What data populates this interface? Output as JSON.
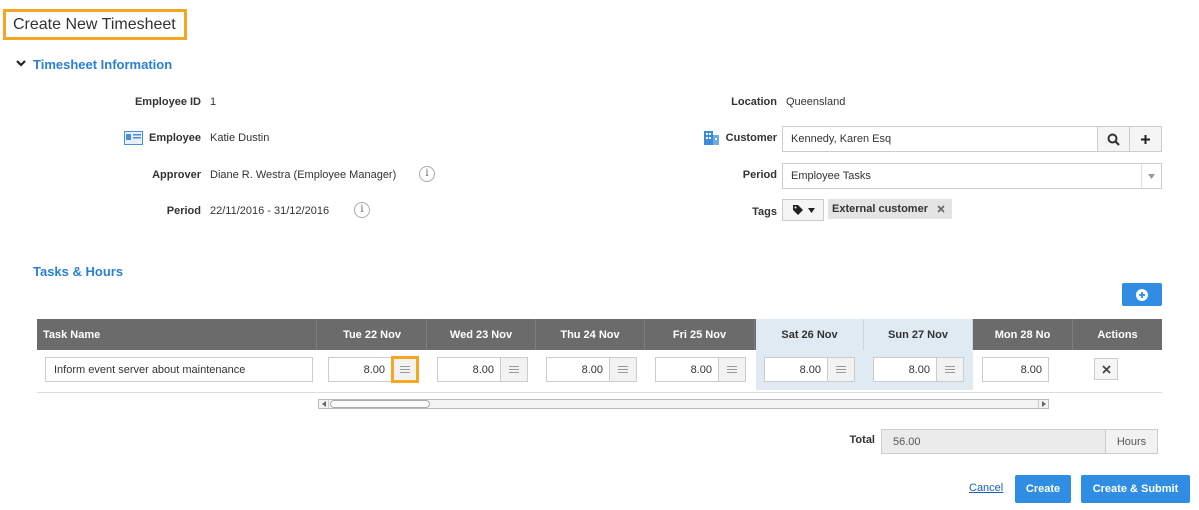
{
  "page": {
    "title": "Create New Timesheet"
  },
  "info_section": {
    "title": "Timesheet Information",
    "employee_id_label": "Employee ID",
    "employee_id": "1",
    "employee_label": "Employee",
    "employee": "Katie Dustin",
    "approver_label": "Approver",
    "approver": "Diane R. Westra (Employee Manager)",
    "period_label": "Period",
    "period": "22/11/2016 - 31/12/2016",
    "location_label": "Location",
    "location": "Queensland",
    "customer_label": "Customer",
    "customer": "Kennedy, Karen Esq",
    "period2_label": "Period",
    "period2": "Employee Tasks",
    "tags_label": "Tags",
    "tag": "External customer",
    "info_glyph": "i"
  },
  "tasks": {
    "title": "Tasks & Hours",
    "columns": {
      "task": "Task Name",
      "d1": "Tue 22 Nov",
      "d2": "Wed 23 Nov",
      "d3": "Thu 24 Nov",
      "d4": "Fri 25 Nov",
      "d5": "Sat 26 Nov",
      "d6": "Sun 27 Nov",
      "d7": "Mon 28 No",
      "actions": "Actions"
    },
    "row": {
      "task_name": "Inform event server about maintenance",
      "h1": "8.00",
      "h2": "8.00",
      "h3": "8.00",
      "h4": "8.00",
      "h5": "8.00",
      "h6": "8.00",
      "h7": "8.00"
    },
    "total_label": "Total",
    "total": "56.00",
    "total_unit": "Hours"
  },
  "actions": {
    "cancel": "Cancel",
    "create": "Create",
    "create_submit": "Create & Submit"
  },
  "colors": {
    "accent": "#2f8de4",
    "highlight": "#f5a623",
    "header": "#6b6b6b",
    "weekend": "#dfeaf3"
  }
}
